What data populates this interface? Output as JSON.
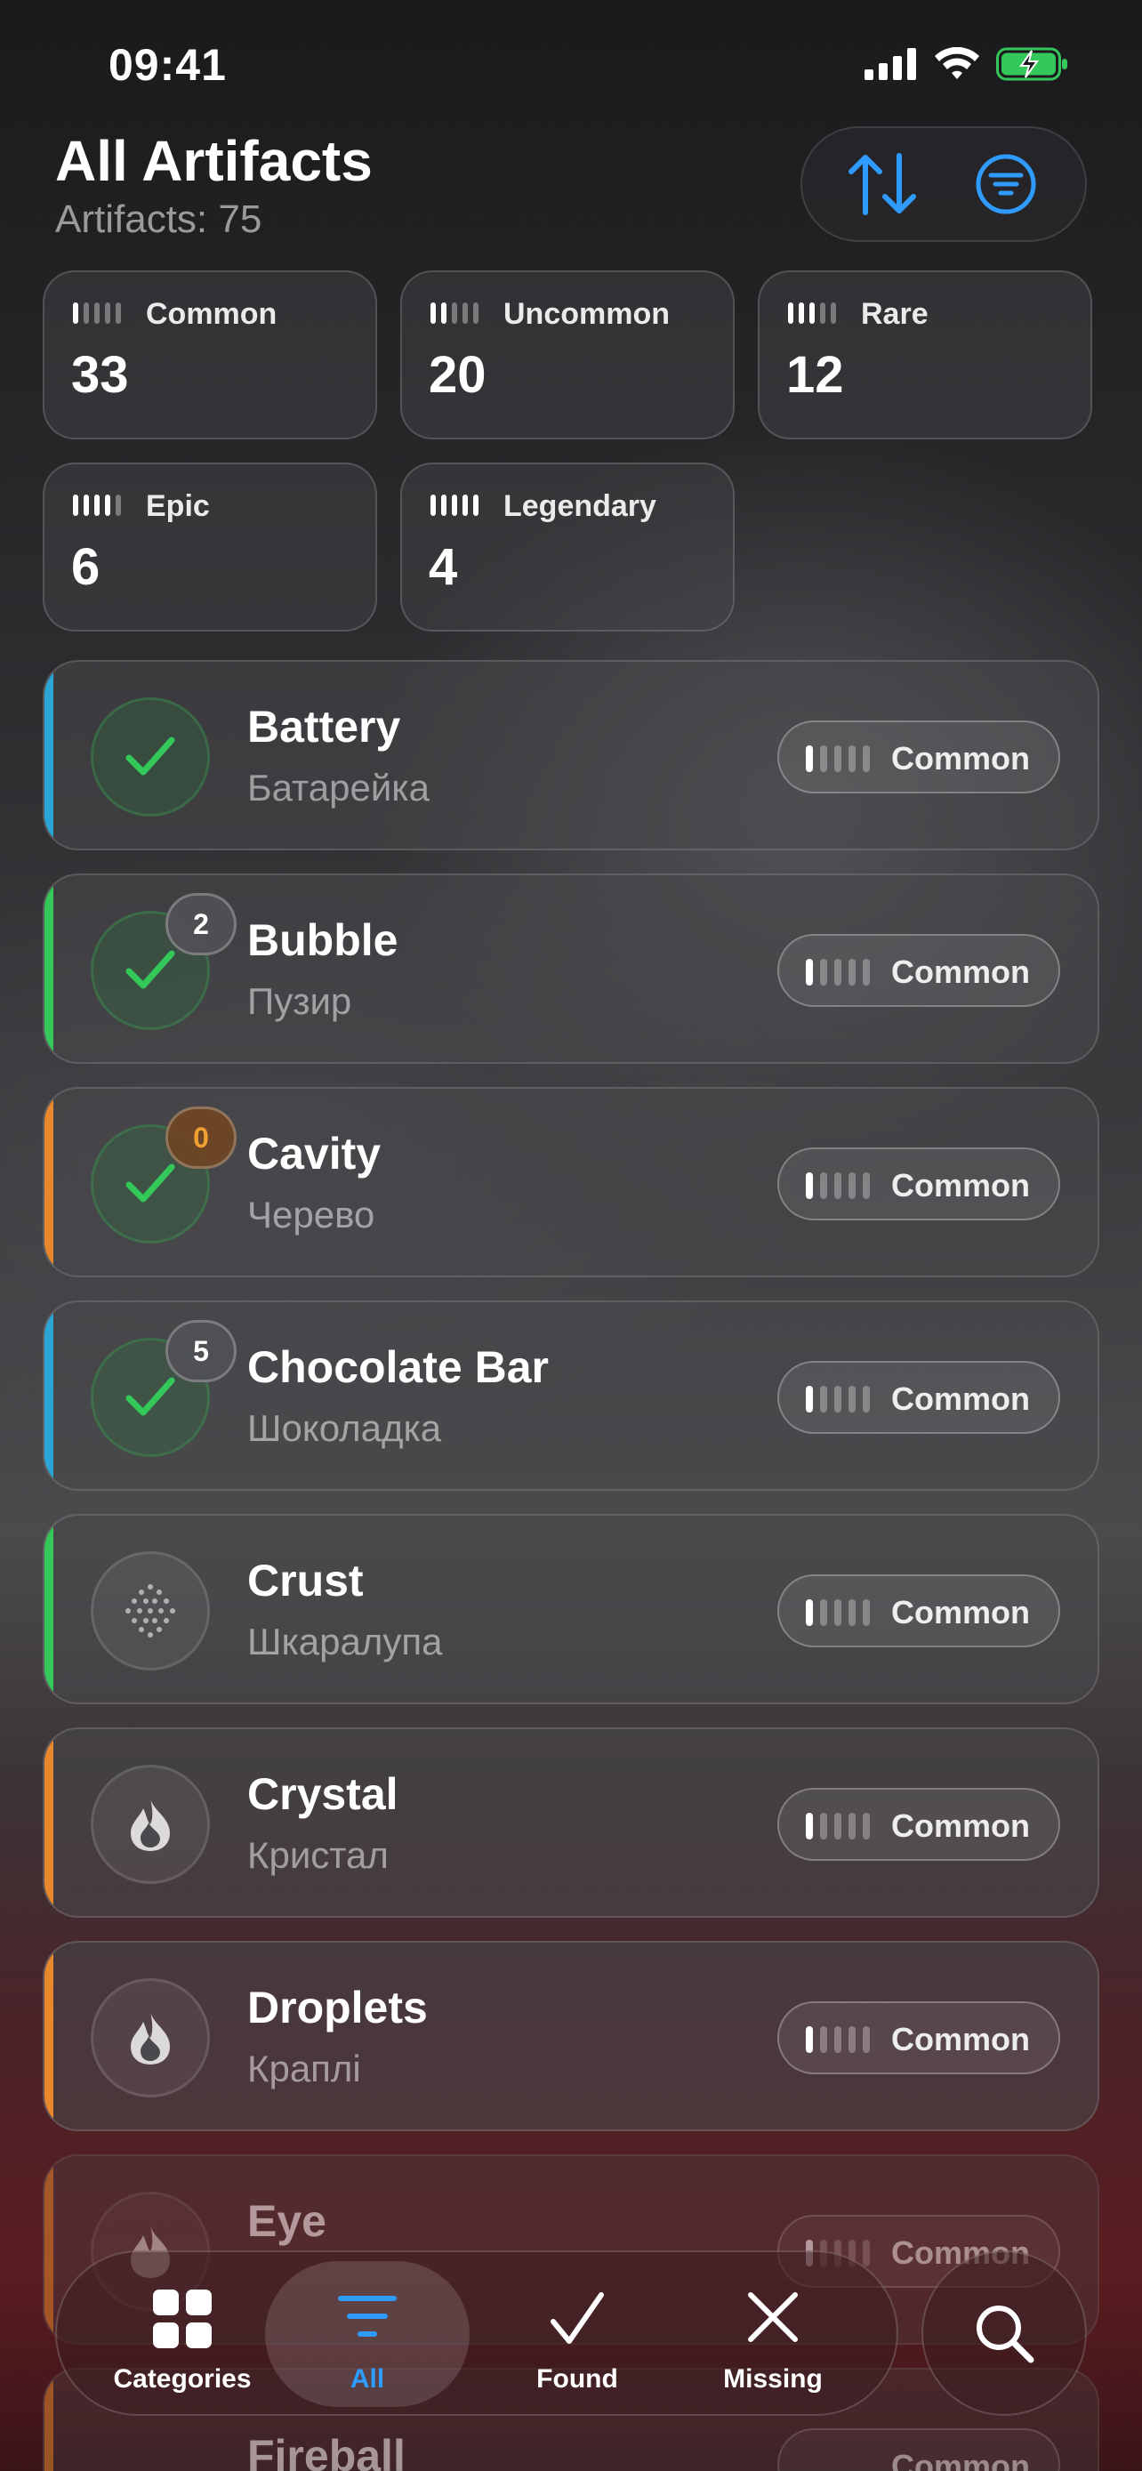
{
  "status": {
    "time": "09:41"
  },
  "header": {
    "title": "All Artifacts",
    "subtitle": "Artifacts: 75",
    "sort_icon": "arrow-up-down-icon",
    "filter_icon": "filter-circle-icon"
  },
  "stats": [
    {
      "label": "Common",
      "count": "33",
      "level": 1
    },
    {
      "label": "Uncommon",
      "count": "20",
      "level": 2
    },
    {
      "label": "Rare",
      "count": "12",
      "level": 3
    },
    {
      "label": "Epic",
      "count": "6",
      "level": 4
    },
    {
      "label": "Legendary",
      "count": "4",
      "level": 5
    }
  ],
  "artifacts": [
    {
      "name": "Battery",
      "ua": "Батарейка",
      "rarity": "Common",
      "found": true,
      "badge": "",
      "accent": "#2aa6d6"
    },
    {
      "name": "Bubble",
      "ua": "Пузир",
      "rarity": "Common",
      "found": true,
      "badge": "2",
      "accent": "#34c759"
    },
    {
      "name": "Cavity",
      "ua": "Черево",
      "rarity": "Common",
      "found": true,
      "badge": "0",
      "accent": "#e8872c"
    },
    {
      "name": "Chocolate Bar",
      "ua": "Шоколадка",
      "rarity": "Common",
      "found": true,
      "badge": "5",
      "accent": "#2aa6d6"
    },
    {
      "name": "Crust",
      "ua": "Шкаралупа",
      "rarity": "Common",
      "found": false,
      "badge": "",
      "accent": "#34c759",
      "icon": "dots-pattern-icon"
    },
    {
      "name": "Crystal",
      "ua": "Кристал",
      "rarity": "Common",
      "found": false,
      "badge": "",
      "accent": "#e8872c",
      "icon": "flame-icon"
    },
    {
      "name": "Droplets",
      "ua": "Краплі",
      "rarity": "Common",
      "found": false,
      "badge": "",
      "accent": "#e8872c",
      "icon": "flame-icon"
    },
    {
      "name": "Eye",
      "ua": "",
      "rarity": "Common",
      "found": false,
      "badge": "",
      "accent": "#e8872c",
      "icon": "flame-icon"
    },
    {
      "name": "Fireball",
      "ua": "",
      "rarity": "Common",
      "found": false,
      "badge": "",
      "accent": "#e8872c",
      "icon": "flame-icon"
    }
  ],
  "tabs": [
    {
      "label": "Categories",
      "icon": "grid-icon"
    },
    {
      "label": "All",
      "icon": "list-filter-icon",
      "active": true
    },
    {
      "label": "Found",
      "icon": "checkmark-icon"
    },
    {
      "label": "Missing",
      "icon": "xmark-icon"
    }
  ],
  "search": {
    "icon": "search-icon"
  },
  "colors": {
    "accent_blue": "#2f9bff",
    "found_green": "#34c759",
    "battery_green": "#34c759"
  }
}
